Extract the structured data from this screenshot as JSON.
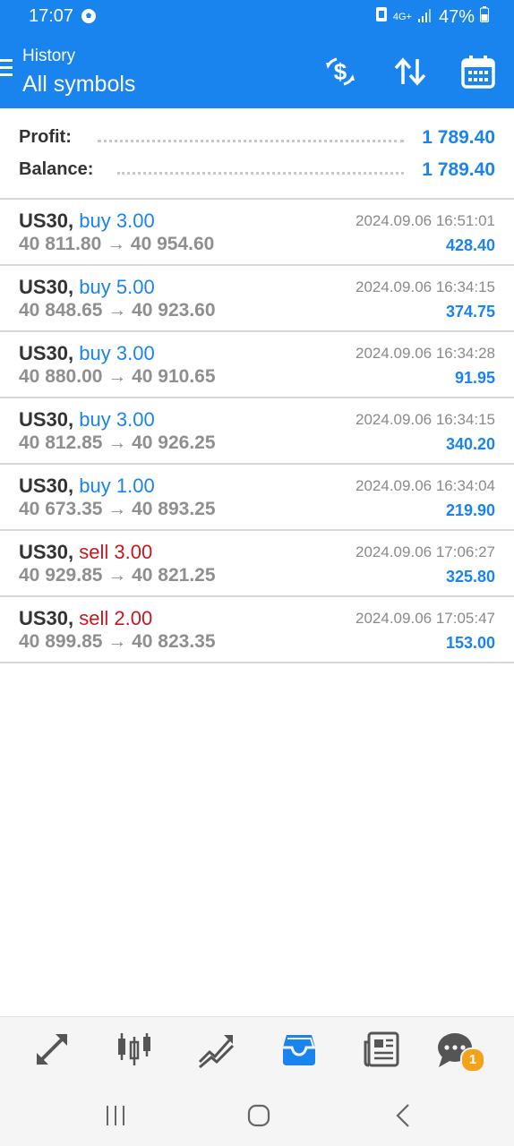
{
  "status": {
    "time": "17:07",
    "network": "4G+",
    "battery": "47%"
  },
  "header": {
    "title": "History",
    "subtitle": "All symbols"
  },
  "summary": {
    "profit_label": "Profit:",
    "profit_value": "1 789.40",
    "balance_label": "Balance:",
    "balance_value": "1 789.40"
  },
  "deals": [
    {
      "symbol": "US30,",
      "type": "buy",
      "volume": "buy 3.00",
      "prices": "40 811.80 → 40 954.60",
      "time": "2024.09.06 16:51:01",
      "profit": "428.40"
    },
    {
      "symbol": "US30,",
      "type": "buy",
      "volume": "buy 5.00",
      "prices": "40 848.65 → 40 923.60",
      "time": "2024.09.06 16:34:15",
      "profit": "374.75"
    },
    {
      "symbol": "US30,",
      "type": "buy",
      "volume": "buy 3.00",
      "prices": "40 880.00 → 40 910.65",
      "time": "2024.09.06 16:34:28",
      "profit": "91.95"
    },
    {
      "symbol": "US30,",
      "type": "buy",
      "volume": "buy 3.00",
      "prices": "40 812.85 → 40 926.25",
      "time": "2024.09.06 16:34:15",
      "profit": "340.20"
    },
    {
      "symbol": "US30,",
      "type": "buy",
      "volume": "buy 1.00",
      "prices": "40 673.35 → 40 893.25",
      "time": "2024.09.06 16:34:04",
      "profit": "219.90"
    },
    {
      "symbol": "US30,",
      "type": "sell",
      "volume": "sell 3.00",
      "prices": "40 929.85 → 40 821.25",
      "time": "2024.09.06 17:06:27",
      "profit": "325.80"
    },
    {
      "symbol": "US30,",
      "type": "sell",
      "volume": "sell 2.00",
      "prices": "40 899.85 → 40 823.35",
      "time": "2024.09.06 17:05:47",
      "profit": "153.00"
    }
  ],
  "bottom_nav": {
    "chat_badge": "1",
    "items": [
      "quotes-icon",
      "chart-icon",
      "trade-icon",
      "history-icon",
      "news-icon",
      "chat-icon"
    ],
    "active": "history-icon"
  },
  "colors": {
    "accent": "#1a84ee",
    "sell": "#c8181f",
    "badge": "#f3a21b"
  }
}
